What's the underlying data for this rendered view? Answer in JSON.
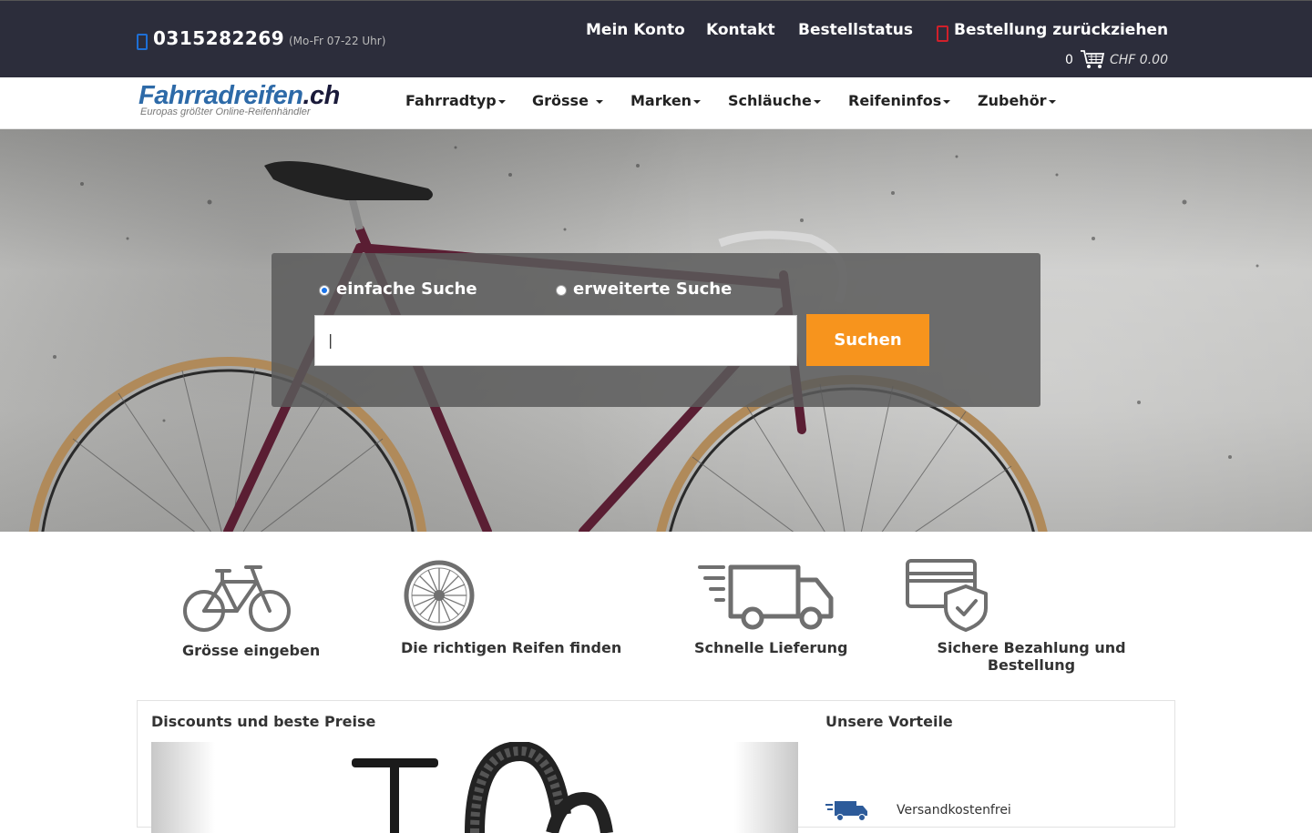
{
  "topbar": {
    "phone": "0315282269",
    "hours": "(Mo-Fr 07-22 Uhr)",
    "links": [
      "Mein Konto",
      "Kontakt",
      "Bestellstatus",
      "Bestellung zurückziehen"
    ],
    "cart_count": "0",
    "cart_total": "CHF 0.00",
    "icons": {
      "phone": "phone-icon",
      "undo": "undo-icon",
      "cart": "cart-icon"
    }
  },
  "logo": {
    "name": "Fahrradreifen",
    "tld": ".ch",
    "tagline": "Europas größter Online-Reifenhändler"
  },
  "nav": {
    "items": [
      "Fahrradtyp",
      "Grösse",
      "Marken",
      "Schläuche",
      "Reifeninfos",
      "Zubehör"
    ]
  },
  "search": {
    "simple_label": "einfache Suche",
    "advanced_label": "erweiterte Suche",
    "selected": "einfache Suche",
    "input_value": "|",
    "button_label": "Suchen"
  },
  "features": [
    {
      "icon": "bicycle-icon",
      "label": "Grösse eingeben"
    },
    {
      "icon": "wheel-icon",
      "label": "Die richtigen Reifen finden"
    },
    {
      "icon": "truck-icon",
      "label": "Schnelle Lieferung"
    },
    {
      "icon": "secure-card-icon",
      "label": "Sichere Bezahlung und Bestellung"
    }
  ],
  "panel": {
    "left_title": "Discounts und beste Preise",
    "right_title": "Unsere Vorteile",
    "vorteile": [
      "Versandkostenfrei"
    ]
  },
  "colors": {
    "topbar_bg": "#2c2d3b",
    "accent_orange": "#f7941d",
    "logo_blue": "#2d6aa8",
    "radio_blue": "#1a73e8"
  }
}
